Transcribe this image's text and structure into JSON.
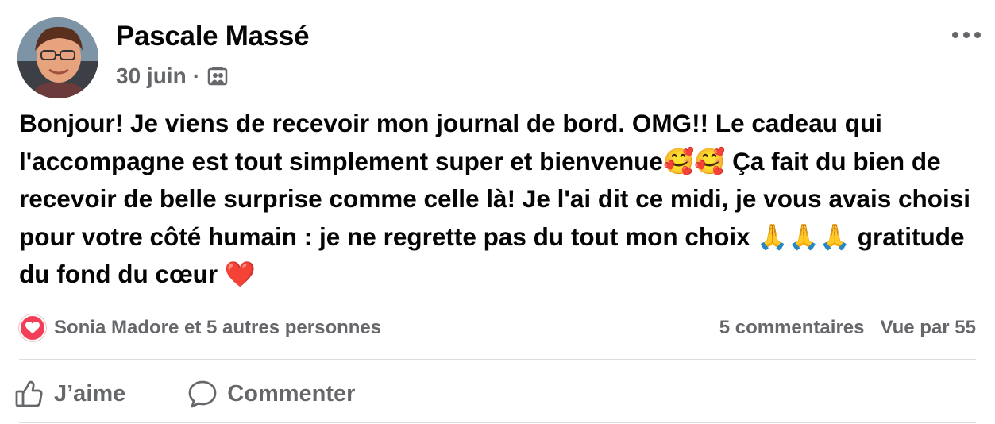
{
  "post": {
    "author": "Pascale Massé",
    "date": "30 juin",
    "separator": "·",
    "audience_icon": "photo-album-icon",
    "text": "Bonjour! Je viens de recevoir mon journal de bord. OMG!! Le cadeau qui l'accompagne est tout simplement super et bienvenue🥰🥰 Ça fait du bien de recevoir de belle surprise comme celle là! Je l'ai dit ce midi, je vous avais choisi pour votre côté humain : je ne regrette pas du tout mon choix 🙏🙏🙏 gratitude du fond du cœur ❤️"
  },
  "reactions": {
    "icon": "love-reaction-icon",
    "summary": "Sonia Madore et 5 autres personnes",
    "comments": "5 commentaires",
    "views": "Vue par 55"
  },
  "actions": {
    "like_label": "J’aime",
    "comment_label": "Commenter"
  },
  "colors": {
    "text": "#050505",
    "secondary": "#65676b",
    "love": "#f33e58",
    "divider": "#dadde1"
  }
}
